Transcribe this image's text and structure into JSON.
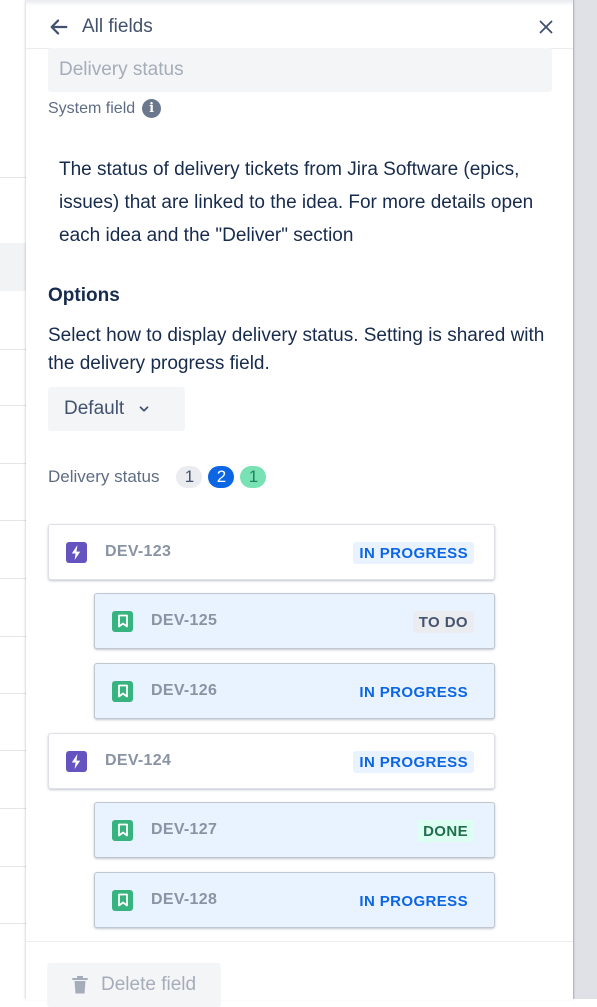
{
  "header": {
    "back_label": "All fields"
  },
  "field": {
    "name_placeholder": "Delivery status",
    "system_label": "System field",
    "info_symbol": "i",
    "description": "The status of delivery tickets from Jira Software (epics, issues) that are linked to the idea. For more details open each idea and the \"Deliver\" section"
  },
  "options": {
    "title": "Options",
    "description": "Select how to display delivery status. Setting is shared with the delivery progress field.",
    "dropdown_value": "Default"
  },
  "delivery_status": {
    "label": "Delivery status",
    "counts": {
      "todo": "1",
      "in_progress": "2",
      "done": "1"
    }
  },
  "tickets": [
    {
      "key": "DEV-123",
      "type": "epic",
      "status": "IN PROGRESS"
    },
    {
      "key": "DEV-125",
      "type": "story",
      "status": "TO DO"
    },
    {
      "key": "DEV-126",
      "type": "story",
      "status": "IN PROGRESS"
    },
    {
      "key": "DEV-124",
      "type": "epic",
      "status": "IN PROGRESS"
    },
    {
      "key": "DEV-127",
      "type": "story",
      "status": "DONE"
    },
    {
      "key": "DEV-128",
      "type": "story",
      "status": "IN PROGRESS"
    }
  ],
  "footer": {
    "delete_label": "Delete field"
  },
  "icons": {
    "back": "arrow-left-icon",
    "close": "close-icon",
    "info": "info-icon",
    "chevron": "chevron-down-icon",
    "epic": "lightning-bolt-icon",
    "story": "bookmark-icon",
    "trash": "trash-icon"
  },
  "colors": {
    "epic": "#6554c0",
    "story": "#36b37e",
    "in_progress": "#0c66e4",
    "done_bg": "#79e2b4"
  }
}
